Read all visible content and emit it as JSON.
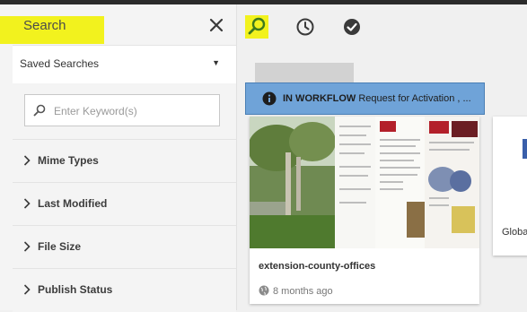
{
  "rail": {
    "title": "Search",
    "saved_searches": "Saved Searches",
    "search_placeholder": "Enter Keyword(s)",
    "facets": [
      {
        "label": "Mime Types"
      },
      {
        "label": "Last Modified"
      },
      {
        "label": "File Size"
      },
      {
        "label": "Publish Status"
      }
    ]
  },
  "toolbar": {
    "search_icon": "search-icon",
    "timeline_icon": "clock-icon",
    "check_icon": "check-icon"
  },
  "workflow_banner": {
    "status": "IN WORKFLOW",
    "text": " Request for Activation , ..."
  },
  "cards": [
    {
      "name": "extension-county-offices",
      "modified": "8 months ago"
    },
    {
      "name": "Globa"
    }
  ],
  "colors": {
    "highlight": "#f2f21e",
    "banner": "#6fa3d8",
    "search_icon": "#3d7a1e"
  }
}
